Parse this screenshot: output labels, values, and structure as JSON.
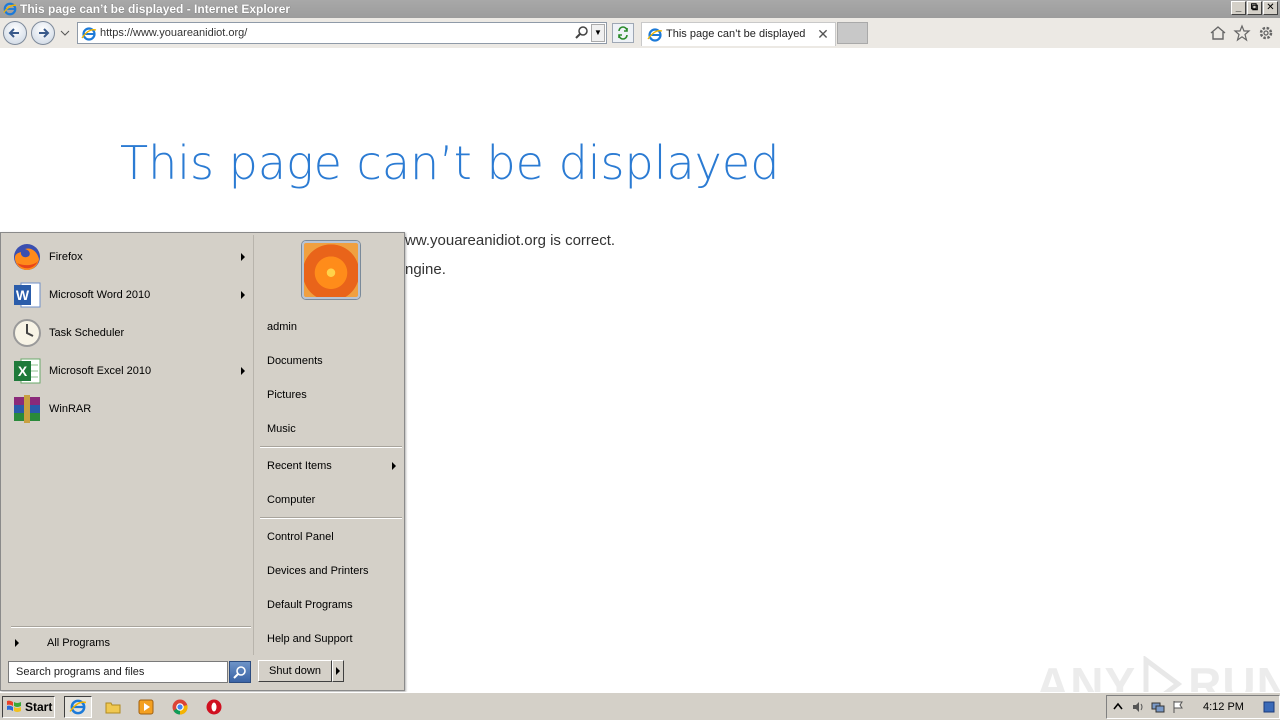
{
  "window": {
    "title": "This page can’t be displayed - Internet Explorer",
    "buttons": {
      "minimize": "_",
      "restore": "⧉",
      "close": "✕"
    }
  },
  "navbar": {
    "url": "https://www.youareanidiot.org/",
    "tab_title": "This page can’t be displayed",
    "tab_close": "✕"
  },
  "page": {
    "heading": "This page can’t be displayed",
    "line1": "ww.youareanidiot.org is correct.",
    "line2": "ngine."
  },
  "watermark": {
    "left": "ANY",
    "right": "RUN"
  },
  "start_menu": {
    "programs": [
      {
        "label": "Firefox",
        "icon": "firefox-icon",
        "has_submenu": true
      },
      {
        "label": "Microsoft Word 2010",
        "icon": "word-icon",
        "has_submenu": true
      },
      {
        "label": "Task Scheduler",
        "icon": "clock-icon",
        "has_submenu": false
      },
      {
        "label": "Microsoft Excel 2010",
        "icon": "excel-icon",
        "has_submenu": true
      },
      {
        "label": "WinRAR",
        "icon": "winrar-icon",
        "has_submenu": false
      }
    ],
    "all_programs": "All Programs",
    "search_placeholder": "Search programs and files",
    "right_items": [
      {
        "label": "admin"
      },
      {
        "label": "Documents"
      },
      {
        "label": "Pictures"
      },
      {
        "label": "Music"
      },
      {
        "label": "Recent Items",
        "has_submenu": true
      },
      {
        "label": "Computer"
      },
      {
        "label": "Control Panel"
      },
      {
        "label": "Devices and Printers"
      },
      {
        "label": "Default Programs"
      },
      {
        "label": "Help and Support"
      }
    ],
    "shutdown": "Shut down"
  },
  "taskbar": {
    "start_label": "Start",
    "quick_launch": [
      "ie-icon",
      "explorer-folder-icon",
      "media-player-icon",
      "chrome-icon",
      "opera-icon"
    ],
    "clock": "4:12 PM"
  },
  "colors": {
    "heading_blue": "#2b7bd3",
    "menu_bg": "#d4d0c8"
  }
}
